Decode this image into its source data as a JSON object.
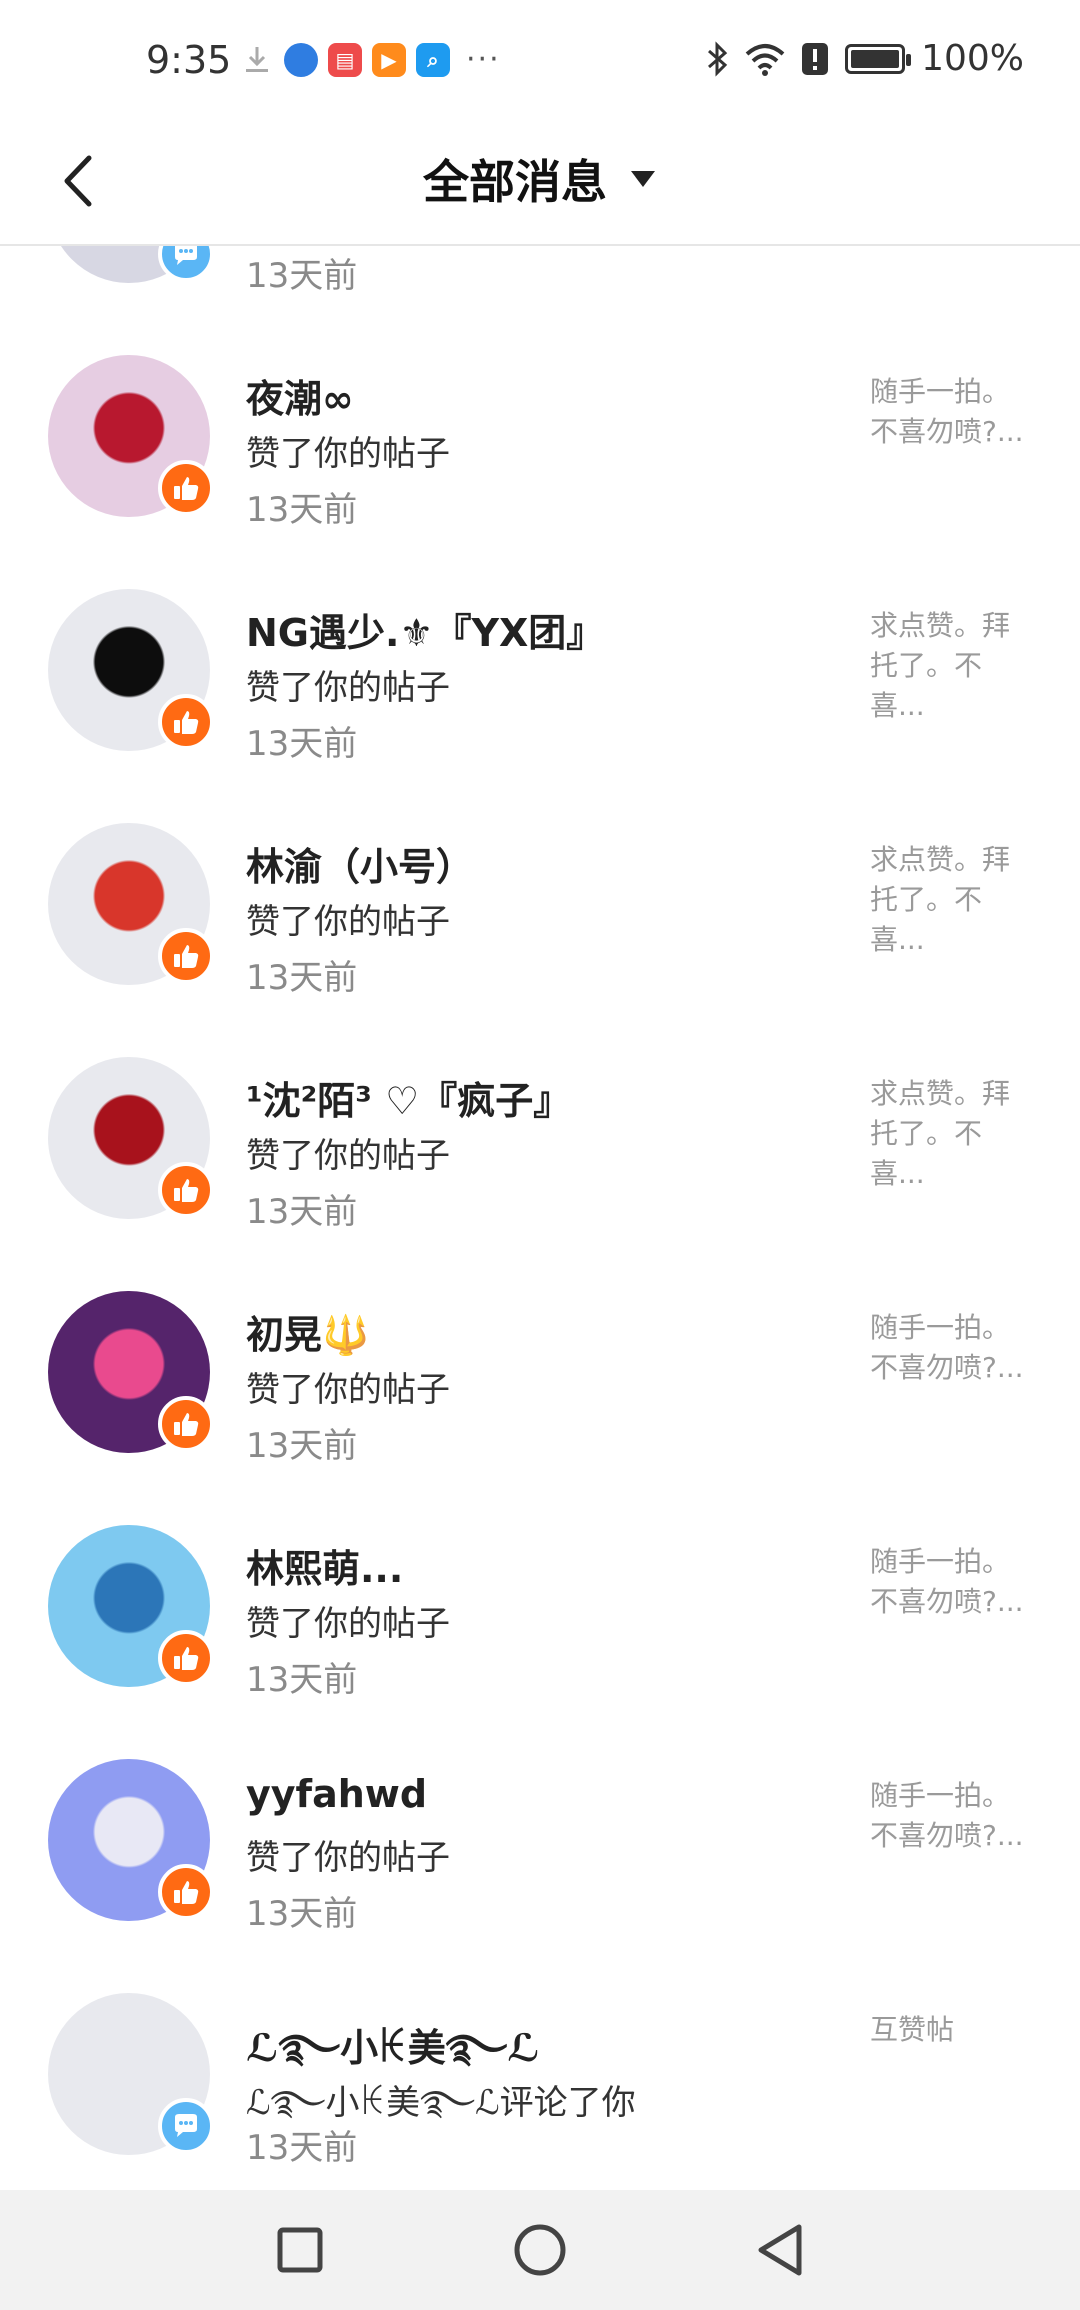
{
  "status_bar": {
    "time": "9:35",
    "more": "···",
    "battery": "100%",
    "battery_level": 1.0,
    "icons": [
      "download-icon",
      "browser-app-icon",
      "red-app-icon",
      "orange-play-app-icon",
      "blue-search-app-icon",
      "bluetooth-icon",
      "wifi-icon",
      "alert-icon",
      "battery-icon"
    ]
  },
  "header": {
    "title": "全部消息",
    "back_icon": "chevron-left-icon",
    "dropdown_icon": "caret-down-icon"
  },
  "notifications": [
    {
      "name": "",
      "action": "",
      "time": "13天前",
      "snippet": "",
      "badge": "comment"
    },
    {
      "name": "夜潮∞",
      "action": "赞了你的帖子",
      "time": "13天前",
      "snippet": "随手一拍。不喜勿喷?...",
      "badge": "like"
    },
    {
      "name": "NG遇少.⚜『YX团』",
      "action": "赞了你的帖子",
      "time": "13天前",
      "snippet": "求点赞。拜托了。不喜...",
      "badge": "like"
    },
    {
      "name": "林渝（小号）",
      "action": "赞了你的帖子",
      "time": "13天前",
      "snippet": "求点赞。拜托了。不喜...",
      "badge": "like"
    },
    {
      "name": "¹沈²陌³ ♡『疯子』",
      "action": "赞了你的帖子",
      "time": "13天前",
      "snippet": "求点赞。拜托了。不喜...",
      "badge": "like"
    },
    {
      "name": "初晃🔱",
      "action": "赞了你的帖子",
      "time": "13天前",
      "snippet": "随手一拍。不喜勿喷?...",
      "badge": "like"
    },
    {
      "name": "林熙萌...",
      "action": "赞了你的帖子",
      "time": "13天前",
      "snippet": "随手一拍。不喜勿喷?...",
      "badge": "like"
    },
    {
      "name": "yyfahwd",
      "action": "赞了你的帖子",
      "time": "13天前",
      "snippet": "随手一拍。不喜勿喷?...",
      "badge": "like"
    },
    {
      "name": "ℒ࿐小ꀘ美࿐ℒ",
      "action": "ℒ࿐小ꀘ美࿐ℒ评论了你",
      "time": "13天前",
      "snippet": "互赞帖",
      "badge": "comment"
    }
  ],
  "nav": {
    "icons": [
      "recents-square-icon",
      "home-circle-icon",
      "back-triangle-icon"
    ]
  }
}
